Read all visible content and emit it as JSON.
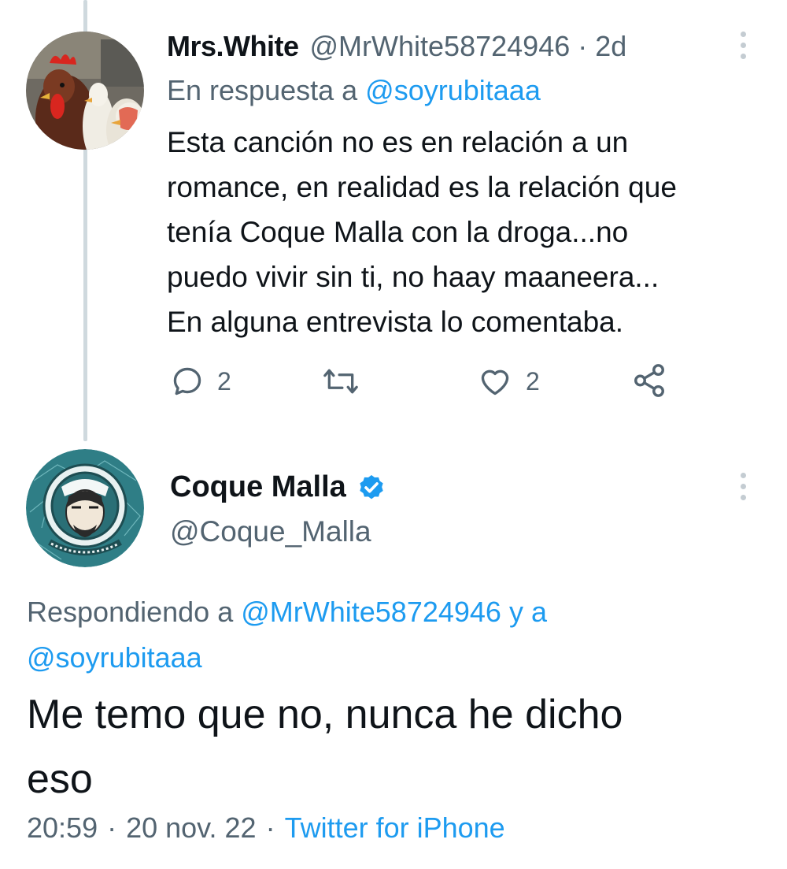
{
  "tweet1": {
    "name": "Mrs.White",
    "handle": "@MrWhite58724946",
    "separator": "·",
    "time": "2d",
    "replying_prefix": "En respuesta a",
    "replying_to": "@soyrubitaaa",
    "text_lines": [
      "Esta canción no es en relación a un",
      "romance, en realidad es la relación que",
      "tenía Coque Malla con la droga...no",
      "puedo vivir sin ti, no haay maaneera...",
      "En alguna entrevista lo comentaba."
    ],
    "reply_count": "2",
    "like_count": "2",
    "avatar_icon": "roosters-avatar"
  },
  "tweet2": {
    "name": "Coque Malla",
    "verified_icon": "verified-badge-icon",
    "handle": "@Coque_Malla",
    "replying_prefix": "Respondiendo a",
    "replying_to_1": "@MrWhite58724946",
    "replying_conj": "y a",
    "replying_to_2": "@soyrubitaaa",
    "text_lines": [
      "Me temo que no, nunca he dicho",
      "eso"
    ],
    "time": "20:59",
    "date": "20 nov. 22",
    "separator": "·",
    "source": "Twitter for iPhone",
    "avatar_icon": "astronaut-avatar"
  },
  "colors": {
    "link": "#1d9bf0",
    "secondary_text": "#536471",
    "primary_text": "#0f1419",
    "thread_line": "#cfd9de"
  }
}
